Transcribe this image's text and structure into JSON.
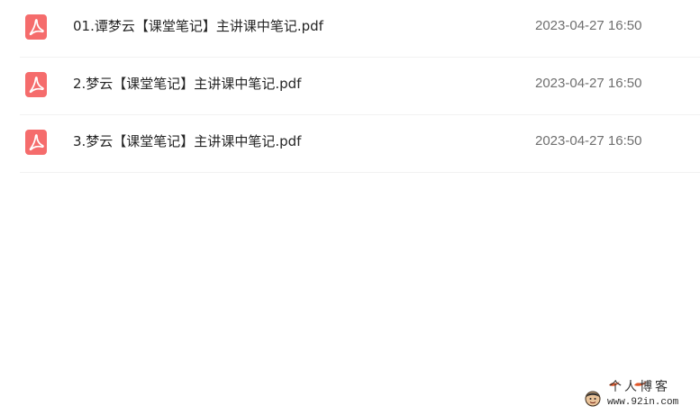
{
  "files": [
    {
      "name": "01.谭梦云【课堂笔记】主讲课中笔记.pdf",
      "date": "2023-04-27 16:50",
      "icon": "pdf-icon"
    },
    {
      "name": "2.梦云【课堂笔记】主讲课中笔记.pdf",
      "date": "2023-04-27 16:50",
      "icon": "pdf-icon"
    },
    {
      "name": "3.梦云【课堂笔记】主讲课中笔记.pdf",
      "date": "2023-04-27 16:50",
      "icon": "pdf-icon"
    }
  ],
  "watermark": {
    "title": "个人博客",
    "url": "www.92in.com"
  },
  "colors": {
    "pdf_icon": "#f56c6c",
    "file_text": "#252525",
    "date_text": "#6f6f6f",
    "row_divider": "#f2f2f2"
  }
}
